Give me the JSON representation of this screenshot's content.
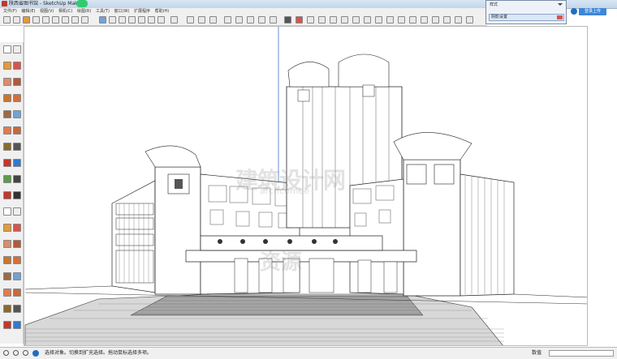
{
  "window": {
    "title": "陕西省图书馆 - SketchUp Make"
  },
  "menubar": {
    "items": [
      "文件(F)",
      "编辑(E)",
      "视图(V)",
      "相机(C)",
      "绘图(R)",
      "工具(T)",
      "窗口(W)",
      "扩展程序",
      "帮助(H)"
    ]
  },
  "styles_panel": {
    "title": "样式",
    "tray_label": "阴影设置"
  },
  "account": {
    "signin_label": "登录上传"
  },
  "statusbar": {
    "hint": "选择对象。切换到扩充选择。拖动鼠标选择多项。",
    "measurements_label": "数值"
  },
  "watermark": {
    "line1": "建筑设计网",
    "line2": "archcomee",
    "line3": "资源"
  },
  "icons": [
    "select-icon",
    "eraser-icon",
    "paint-bucket-icon",
    "line-icon",
    "arc-icon",
    "rectangle-icon",
    "circle-icon",
    "push-pull-icon",
    "move-icon",
    "rotate-icon",
    "scale-icon",
    "offset-icon",
    "tape-measure-icon",
    "text-icon",
    "axes-icon",
    "orbit-icon",
    "pan-icon",
    "zoom-icon",
    "walk-icon",
    "section-icon"
  ]
}
